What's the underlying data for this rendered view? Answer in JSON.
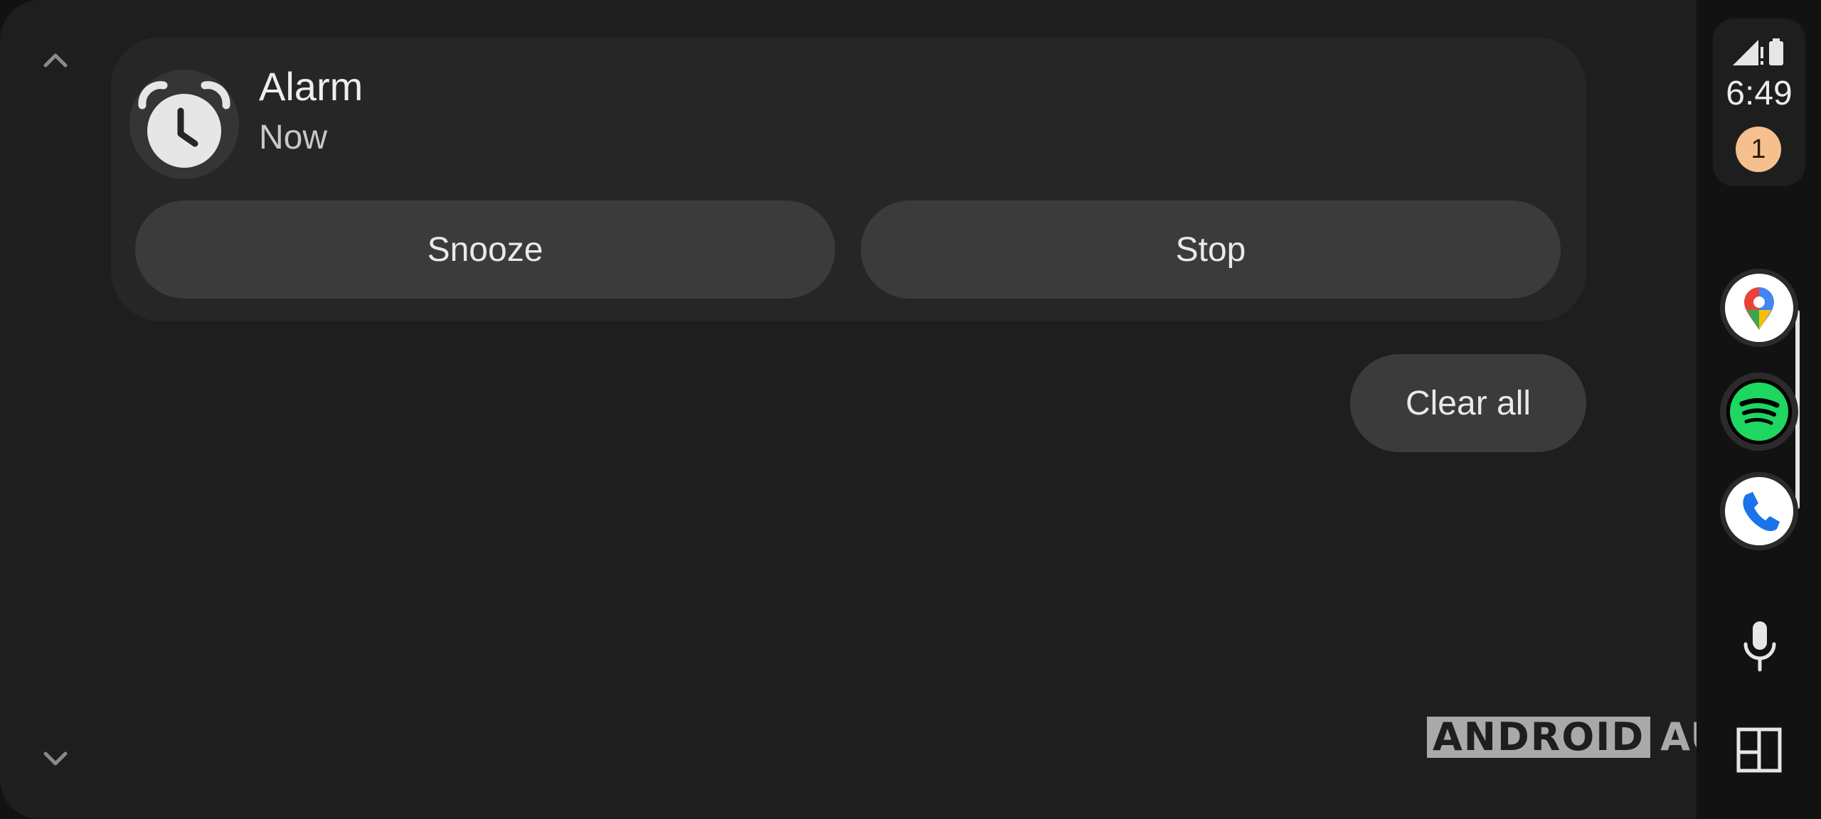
{
  "notification": {
    "app_icon": "alarm-clock-icon",
    "title": "Alarm",
    "time": "Now",
    "actions": [
      "Snooze",
      "Stop"
    ]
  },
  "clear_all_label": "Clear all",
  "status": {
    "time": "6:49",
    "notification_count": "1",
    "icons": [
      "signal-icon",
      "battery-icon"
    ]
  },
  "rail_apps": [
    {
      "name": "Google Maps",
      "icon": "maps-icon"
    },
    {
      "name": "Spotify",
      "icon": "spotify-icon"
    },
    {
      "name": "Phone",
      "icon": "phone-icon"
    }
  ],
  "rail_controls": [
    "mic-icon",
    "launcher-icon"
  ],
  "watermark": {
    "part1": "ANDROID",
    "part2": "AUTHORITY"
  },
  "colors": {
    "background": "#1e1e1f",
    "card": "#262627",
    "button": "#3b3b3c",
    "badge": "#f6c08e",
    "spotify_green": "#1ed760"
  }
}
